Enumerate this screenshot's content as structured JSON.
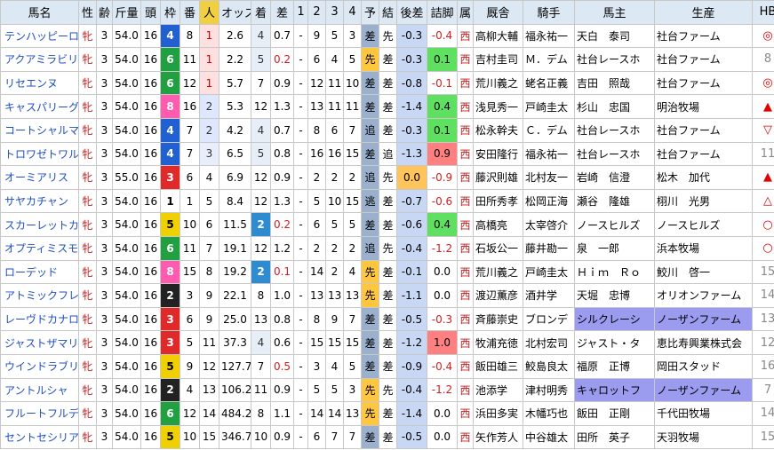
{
  "headers": [
    "馬名",
    "性",
    "齢",
    "斤量",
    "頭",
    "枠",
    "番",
    "人",
    "オッズ",
    "着",
    "差",
    "1",
    "2",
    "3",
    "4",
    "予",
    "結",
    "後差",
    "詰脚",
    "属",
    "厩舎",
    "騎手",
    "馬主",
    "生産",
    "HB"
  ],
  "rows": [
    {
      "name": "テンハッピーローズ",
      "sex": "牝",
      "age": "3",
      "kin": "54.0",
      "tou": "16",
      "waku": "4",
      "ban": "8",
      "pop": "1",
      "odds": "2.6",
      "chaku": "4",
      "sa": "0.7",
      "c1": "-",
      "c2": "9",
      "c3": "5",
      "c4": "3",
      "yo": "差",
      "ketsu": "先",
      "ato": "-0.3",
      "tsume": "-0.4",
      "zoku": "西",
      "kyusha": "高柳大輔",
      "kishu": "福永祐一",
      "umanushi": "天白　泰司",
      "seisan": "社台ファーム",
      "hb": "◎"
    },
    {
      "name": "アクアミラビリス",
      "sex": "牝",
      "age": "3",
      "kin": "54.0",
      "tou": "16",
      "waku": "6",
      "ban": "11",
      "pop": "1",
      "odds": "2.2",
      "chaku": "5",
      "sa": "0.2",
      "c1": "-",
      "c2": "6",
      "c3": "4",
      "c4": "5",
      "yo": "先",
      "ketsu": "差",
      "ato": "-0.3",
      "tsume": "0.1",
      "zoku": "西",
      "kyusha": "吉村圭司",
      "kishu": "Ｍ．デム",
      "umanushi": "社台レースホ",
      "seisan": "社台ファーム",
      "hb": "8"
    },
    {
      "name": "リセエンヌ",
      "sex": "牝",
      "age": "3",
      "kin": "54.0",
      "tou": "16",
      "waku": "6",
      "ban": "12",
      "pop": "1",
      "odds": "5.7",
      "chaku": "7",
      "sa": "0.9",
      "c1": "-",
      "c2": "12",
      "c3": "11",
      "c4": "10",
      "yo": "差",
      "ketsu": "差",
      "ato": "-0.8",
      "tsume": "-0.1",
      "zoku": "西",
      "kyusha": "荒川義之",
      "kishu": "蛯名正義",
      "umanushi": "吉田　照哉",
      "seisan": "社台ファーム",
      "hb": "◎"
    },
    {
      "name": "キャスパリーグ",
      "sex": "牝",
      "age": "3",
      "kin": "54.0",
      "tou": "16",
      "waku": "8",
      "ban": "16",
      "pop": "2",
      "odds": "5.3",
      "chaku": "12",
      "sa": "1.3",
      "c1": "-",
      "c2": "13",
      "c3": "11",
      "c4": "11",
      "yo": "差",
      "ketsu": "差",
      "ato": "-1.4",
      "tsume": "0.4",
      "zoku": "西",
      "kyusha": "浅見秀一",
      "kishu": "戸崎圭太",
      "umanushi": "杉山　忠国",
      "seisan": "明治牧場",
      "hb": "▲"
    },
    {
      "name": "コートシャルマン",
      "sex": "牝",
      "age": "3",
      "kin": "54.0",
      "tou": "16",
      "waku": "4",
      "ban": "7",
      "pop": "2",
      "odds": "4.2",
      "chaku": "4",
      "sa": "0.7",
      "c1": "-",
      "c2": "8",
      "c3": "6",
      "c4": "7",
      "yo": "追",
      "ketsu": "差",
      "ato": "-0.3",
      "tsume": "0.1",
      "zoku": "西",
      "kyusha": "松永幹夫",
      "kishu": "Ｃ．デム",
      "umanushi": "社台レースホ",
      "seisan": "社台ファーム",
      "hb": "▽"
    },
    {
      "name": "トロワゼトワル",
      "sex": "牝",
      "age": "3",
      "kin": "54.0",
      "tou": "16",
      "waku": "4",
      "ban": "7",
      "pop": "3",
      "odds": "6.5",
      "chaku": "5",
      "sa": "0.8",
      "c1": "-",
      "c2": "16",
      "c3": "16",
      "c4": "15",
      "yo": "差",
      "ketsu": "追",
      "ato": "-1.3",
      "tsume": "0.9",
      "zoku": "西",
      "kyusha": "安田隆行",
      "kishu": "福永祐一",
      "umanushi": "社台レースホ",
      "seisan": "社台ファーム",
      "hb": "11"
    },
    {
      "name": "オーミアリス",
      "sex": "牝",
      "age": "3",
      "kin": "55.0",
      "tou": "16",
      "waku": "3",
      "ban": "6",
      "pop": "4",
      "odds": "6.9",
      "chaku": "12",
      "sa": "0.9",
      "c1": "-",
      "c2": "2",
      "c3": "2",
      "c4": "2",
      "yo": "追",
      "ketsu": "先",
      "ato": "0.0",
      "tsume": "-0.9",
      "zoku": "西",
      "kyusha": "藤沢則雄",
      "kishu": "北村友一",
      "umanushi": "岩崎　信澄",
      "seisan": "松木　加代",
      "hb": "▲"
    },
    {
      "name": "サヤカチャン",
      "sex": "牝",
      "age": "3",
      "kin": "54.0",
      "tou": "16",
      "waku": "1",
      "ban": "1",
      "pop": "5",
      "odds": "8.4",
      "chaku": "12",
      "sa": "1.3",
      "c1": "-",
      "c2": "5",
      "c3": "10",
      "c4": "15",
      "yo": "逃",
      "ketsu": "差",
      "ato": "-0.7",
      "tsume": "-0.6",
      "zoku": "西",
      "kyusha": "田所秀孝",
      "kishu": "松岡正海",
      "umanushi": "瀬谷　隆雄",
      "seisan": "栩川　光男",
      "hb": "△"
    },
    {
      "name": "スカーレットカラー",
      "sex": "牝",
      "age": "3",
      "kin": "54.0",
      "tou": "16",
      "waku": "5",
      "ban": "10",
      "pop": "6",
      "odds": "11.5",
      "chaku": "2",
      "sa": "0.2",
      "c1": "-",
      "c2": "6",
      "c3": "5",
      "c4": "5",
      "yo": "差",
      "ketsu": "差",
      "ato": "-0.6",
      "tsume": "0.4",
      "zoku": "西",
      "kyusha": "高橋亮",
      "kishu": "太宰啓介",
      "umanushi": "ノースヒルズ",
      "seisan": "ノースヒルズ",
      "hb": "○"
    },
    {
      "name": "オプティミスモ",
      "sex": "牝",
      "age": "3",
      "kin": "54.0",
      "tou": "16",
      "waku": "6",
      "ban": "11",
      "pop": "7",
      "odds": "19.1",
      "chaku": "12",
      "sa": "1.2",
      "c1": "-",
      "c2": "2",
      "c3": "2",
      "c4": "2",
      "yo": "追",
      "ketsu": "先",
      "ato": "-0.4",
      "tsume": "-1.2",
      "zoku": "西",
      "kyusha": "石坂公一",
      "kishu": "藤井勘一",
      "umanushi": "泉　一郎",
      "seisan": "浜本牧場",
      "hb": "○"
    },
    {
      "name": "ローデッド",
      "sex": "牝",
      "age": "3",
      "kin": "54.0",
      "tou": "16",
      "waku": "8",
      "ban": "15",
      "pop": "8",
      "odds": "19.2",
      "chaku": "2",
      "sa": "0.1",
      "c1": "-",
      "c2": "14",
      "c3": "2",
      "c4": "4",
      "yo": "先",
      "ketsu": "差",
      "ato": "-0.1",
      "tsume": "0.0",
      "zoku": "西",
      "kyusha": "荒川義之",
      "kishu": "戸崎圭太",
      "umanushi": "Ｈｉｍ　Ｒｏ",
      "seisan": "鮫川　啓一",
      "hb": "15"
    },
    {
      "name": "アトミックフレア",
      "sex": "牝",
      "age": "3",
      "kin": "54.0",
      "tou": "16",
      "waku": "2",
      "ban": "3",
      "pop": "9",
      "odds": "22.1",
      "chaku": "8",
      "sa": "1.0",
      "c1": "-",
      "c2": "13",
      "c3": "13",
      "c4": "13",
      "yo": "先",
      "ketsu": "差",
      "ato": "-1.1",
      "tsume": "0.0",
      "zoku": "西",
      "kyusha": "渡辺薫彦",
      "kishu": "酒井学",
      "umanushi": "天堀　忠博",
      "seisan": "オリオンファーム",
      "hb": "14"
    },
    {
      "name": "レーヴドカナロア",
      "sex": "牝",
      "age": "3",
      "kin": "54.0",
      "tou": "16",
      "waku": "3",
      "ban": "6",
      "pop": "9",
      "odds": "25.0",
      "chaku": "13",
      "sa": "0.8",
      "c1": "-",
      "c2": "8",
      "c3": "9",
      "c4": "7",
      "yo": "差",
      "ketsu": "差",
      "ato": "-0.5",
      "tsume": "-0.3",
      "zoku": "西",
      "kyusha": "斉藤崇史",
      "kishu": "ブロンデ",
      "umanushi": "シルクレーシ",
      "seisan": "ノーザンファーム",
      "hb": "13",
      "hl": true
    },
    {
      "name": "ジャストザマリン",
      "sex": "牝",
      "age": "3",
      "kin": "54.0",
      "tou": "16",
      "waku": "3",
      "ban": "5",
      "pop": "11",
      "odds": "37.3",
      "chaku": "4",
      "sa": "0.6",
      "c1": "-",
      "c2": "15",
      "c3": "15",
      "c4": "15",
      "yo": "差",
      "ketsu": "差",
      "ato": "-1.2",
      "tsume": "1.0",
      "zoku": "西",
      "kyusha": "牧浦充徳",
      "kishu": "北村宏司",
      "umanushi": "ジャスト・タ",
      "seisan": "恵比寿興業株式会",
      "hb": "12"
    },
    {
      "name": "ウインドラブリーナ",
      "sex": "牝",
      "age": "3",
      "kin": "54.0",
      "tou": "16",
      "waku": "5",
      "ban": "9",
      "pop": "12",
      "odds": "127.7",
      "chaku": "7",
      "sa": "0.5",
      "c1": "-",
      "c2": "3",
      "c3": "4",
      "c4": "5",
      "yo": "差",
      "ketsu": "差",
      "ato": "-0.9",
      "tsume": "-0.4",
      "zoku": "西",
      "kyusha": "飯田雄三",
      "kishu": "鮫島良太",
      "umanushi": "福原　正博",
      "seisan": "岡田スタッド",
      "hb": "16"
    },
    {
      "name": "アントルシャ",
      "sex": "牝",
      "age": "3",
      "kin": "54.0",
      "tou": "16",
      "waku": "2",
      "ban": "4",
      "pop": "13",
      "odds": "106.2",
      "chaku": "11",
      "sa": "0.9",
      "c1": "-",
      "c2": "5",
      "c3": "5",
      "c4": "3",
      "yo": "先",
      "ketsu": "先",
      "ato": "-0.4",
      "tsume": "-1.2",
      "zoku": "西",
      "kyusha": "池添学",
      "kishu": "津村明秀",
      "umanushi": "キャロットフ",
      "seisan": "ノーザンファーム",
      "hb": "7",
      "hl": true
    },
    {
      "name": "フルートフルデイズ",
      "sex": "牝",
      "age": "3",
      "kin": "54.0",
      "tou": "16",
      "waku": "6",
      "ban": "12",
      "pop": "14",
      "odds": "484.2",
      "chaku": "8",
      "sa": "1.1",
      "c1": "-",
      "c2": "14",
      "c3": "14",
      "c4": "13",
      "yo": "先",
      "ketsu": "差",
      "ato": "-1.4",
      "tsume": "0.0",
      "zoku": "西",
      "kyusha": "浜田多実",
      "kishu": "木幡巧也",
      "umanushi": "飯田　正剛",
      "seisan": "千代田牧場",
      "hb": "14"
    },
    {
      "name": "セントセシリア",
      "sex": "牝",
      "age": "3",
      "kin": "54.0",
      "tou": "16",
      "waku": "5",
      "ban": "10",
      "pop": "15",
      "odds": "346.7",
      "chaku": "10",
      "sa": "0.9",
      "c1": "-",
      "c2": "6",
      "c3": "7",
      "c4": "7",
      "yo": "差",
      "ketsu": "差",
      "ato": "-0.5",
      "tsume": "0.0",
      "zoku": "西",
      "kyusha": "矢作芳人",
      "kishu": "中谷雄太",
      "umanushi": "田所　英子",
      "seisan": "天羽牧場",
      "hb": "15"
    }
  ]
}
